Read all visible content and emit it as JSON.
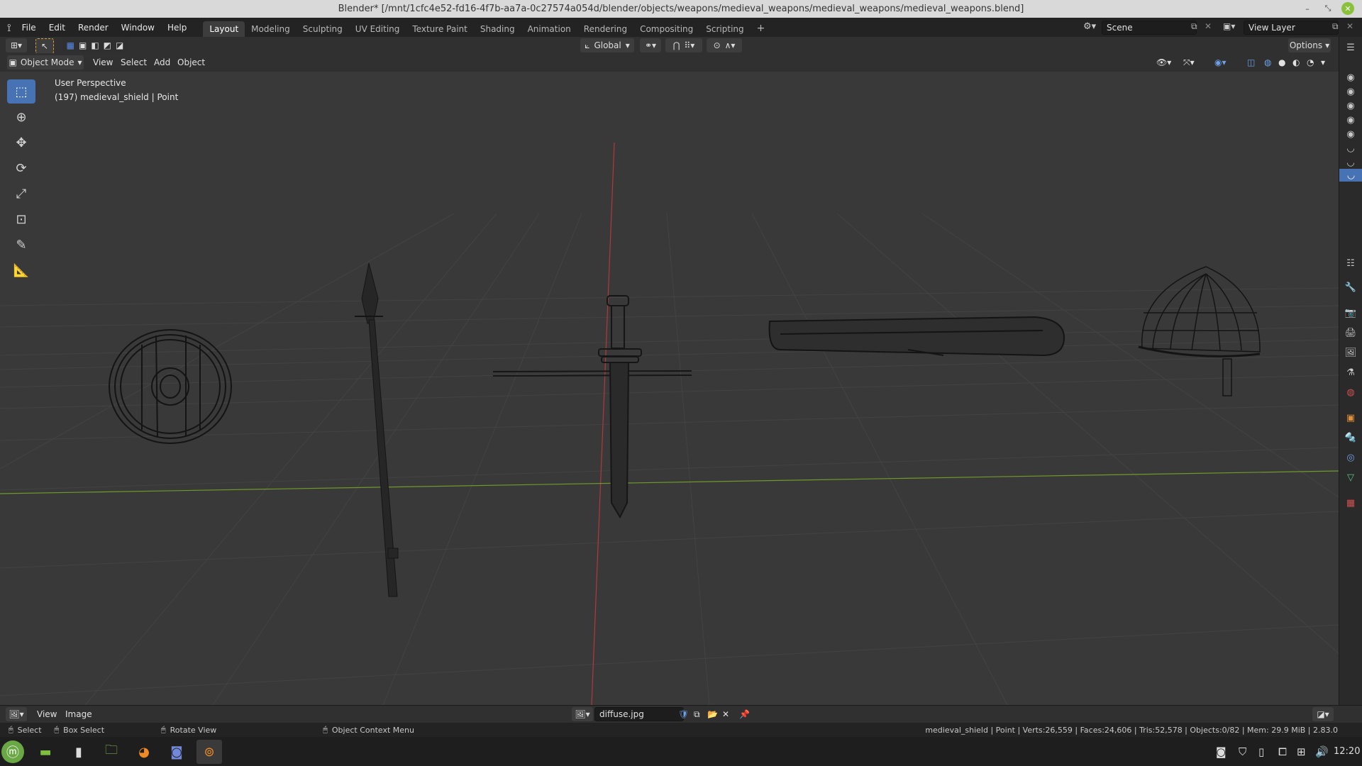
{
  "window": {
    "title": "Blender* [/mnt/1cfc4e52-fd16-4f7b-aa7a-0c27574a054d/blender/objects/weapons/medieval_weapons/medieval_weapons/medieval_weapons.blend]"
  },
  "menu": {
    "items": [
      "File",
      "Edit",
      "Render",
      "Window",
      "Help"
    ],
    "workspaces": [
      "Layout",
      "Modeling",
      "Sculpting",
      "UV Editing",
      "Texture Paint",
      "Shading",
      "Animation",
      "Rendering",
      "Compositing",
      "Scripting"
    ],
    "active_workspace": "Layout",
    "add_tab": "+",
    "scene_value": "Scene",
    "view_layer_value": "View Layer"
  },
  "header": {
    "transform_orientation": "Global",
    "options_label": "Options",
    "mode": "Object Mode",
    "view_menu": [
      "View",
      "Select",
      "Add",
      "Object"
    ]
  },
  "viewport": {
    "perspective_label": "User Perspective",
    "object_info": "(197) medieval_shield | Point"
  },
  "image_editor": {
    "menus": [
      "View",
      "Image"
    ],
    "image_name": "diffuse.jpg"
  },
  "statusbar": {
    "select": "Select",
    "box_select": "Box Select",
    "rotate_view": "Rotate View",
    "context_menu": "Object Context Menu",
    "stats": "medieval_shield | Point | Verts:26,559 | Faces:24,606 | Tris:52,578 | Objects:0/82 | Mem: 29.9 MiB | 2.83.0"
  },
  "taskbar": {
    "clock": "12:20"
  },
  "colors": {
    "accent_blue": "#4772b3",
    "x_axis": "#b03a3a",
    "y_axis": "#6f9a2a",
    "viewport_bg": "#393939"
  }
}
